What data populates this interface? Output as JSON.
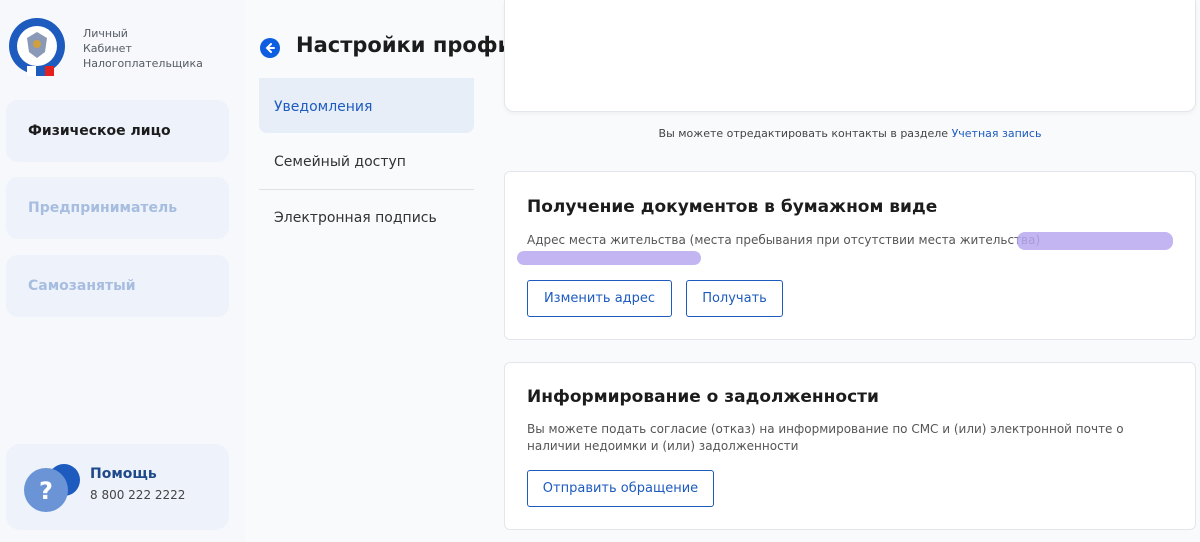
{
  "brand": {
    "lines": [
      "Личный",
      "Кабинет",
      "Налогоплательщика"
    ]
  },
  "sidebar": {
    "roles": [
      {
        "label": "Физическое лицо",
        "active": true
      },
      {
        "label": "Предприниматель",
        "active": false
      },
      {
        "label": "Самозанятый",
        "active": false
      }
    ],
    "help": {
      "title": "Помощь",
      "phone": "8 800 222 2222"
    }
  },
  "header": {
    "title": "Настройки профиля",
    "icons": [
      "search-icon",
      "mail-icon",
      "eye-off-icon",
      "lightbulb-icon",
      "user-icon"
    ]
  },
  "settings_menu": {
    "items": [
      "Уведомления",
      "Семейный доступ",
      "Электронная подпись"
    ]
  },
  "contacts_hint": {
    "text": "Вы можете отредактировать контакты в разделе",
    "link": "Учетная запись"
  },
  "paper_docs": {
    "title": "Получение документов в бумажном виде",
    "address_label": "Адрес места жительства (места пребывания при отсутствии места жительства)",
    "change_button": "Изменить адрес",
    "receive_button": "Получать"
  },
  "debt_info": {
    "title": "Информирование о задолженности",
    "text": "Вы можете подать согласие (отказ) на информирование по СМС и (или) электронной почте о наличии недоимки и (или) задолженности",
    "button": "Отправить обращение"
  },
  "colors": {
    "accent": "#1d5bbf",
    "notification": "#e32020",
    "redaction": "#b8a8ee"
  }
}
